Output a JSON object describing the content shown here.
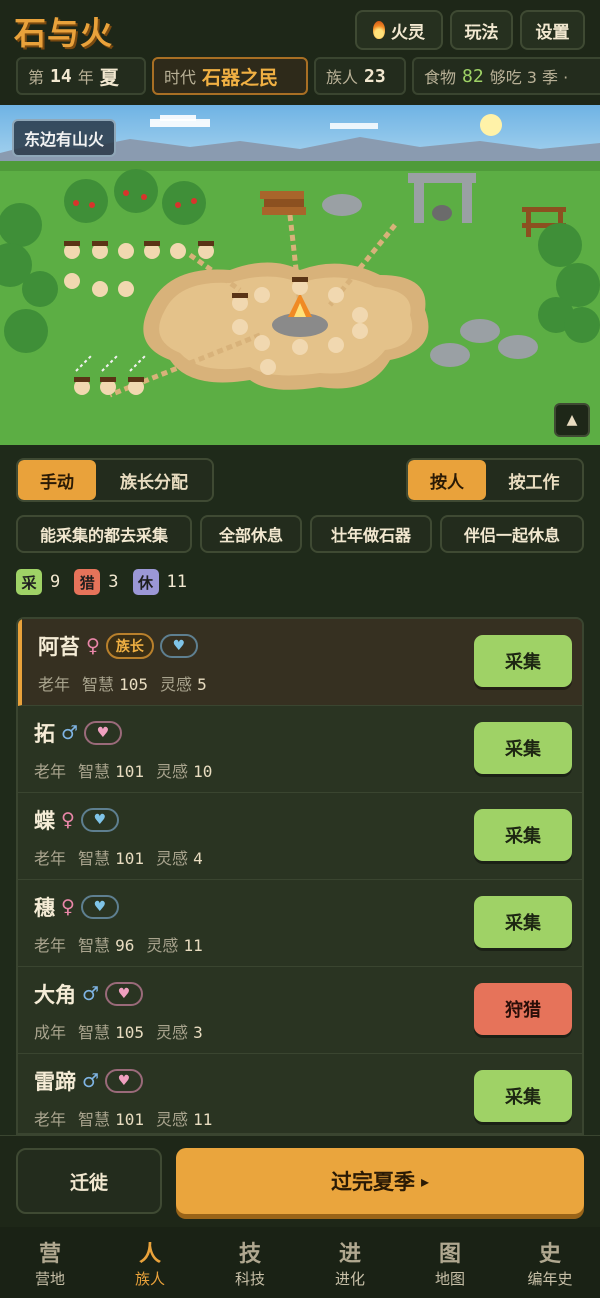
{
  "header": {
    "logo": "石与火",
    "buttons": {
      "fire_spirit": "火灵",
      "how_to_play": "玩法",
      "settings": "设置"
    }
  },
  "status": {
    "year_prefix": "第",
    "year": "14",
    "year_suffix": "年",
    "season": "夏",
    "era_label": "时代",
    "era_value": "石器之民",
    "population_label": "族人",
    "population": "23",
    "food_label": "食物",
    "food": "82",
    "food_note": "够吃 3 季 ·"
  },
  "scene": {
    "event_tag": "东边有山火",
    "expand_icon": "▲"
  },
  "controls": {
    "mode_tabs": [
      "手动",
      "族长分配"
    ],
    "mode_active": 0,
    "sort_tabs": [
      "按人",
      "按工作"
    ],
    "sort_active": 0,
    "quick_actions": [
      "能采集的都去采集",
      "全部休息",
      "壮年做石器",
      "伴侣一起休息"
    ]
  },
  "job_counts": [
    {
      "label": "采",
      "count": "9",
      "color": "#9fd266"
    },
    {
      "label": "猎",
      "count": "3",
      "color": "#e6735a"
    },
    {
      "label": "休",
      "count": "11",
      "color": "#9b97d6"
    }
  ],
  "people": [
    {
      "name": "阿苔",
      "gender": "♀",
      "chief": "族长",
      "heart": "♥",
      "age": "老年",
      "wisdom_label": "智慧",
      "wisdom": "105",
      "insight_label": "灵感",
      "insight": "5",
      "job": "采集"
    },
    {
      "name": "拓",
      "gender": "♂",
      "heart": "♥",
      "age": "老年",
      "wisdom_label": "智慧",
      "wisdom": "101",
      "insight_label": "灵感",
      "insight": "10",
      "job": "采集"
    },
    {
      "name": "蝶",
      "gender": "♀",
      "heart": "♥",
      "age": "老年",
      "wisdom_label": "智慧",
      "wisdom": "101",
      "insight_label": "灵感",
      "insight": "4",
      "job": "采集"
    },
    {
      "name": "穗",
      "gender": "♀",
      "heart": "♥",
      "age": "老年",
      "wisdom_label": "智慧",
      "wisdom": "96",
      "insight_label": "灵感",
      "insight": "11",
      "job": "采集"
    },
    {
      "name": "大角",
      "gender": "♂",
      "heart": "♥",
      "age": "成年",
      "wisdom_label": "智慧",
      "wisdom": "105",
      "insight_label": "灵感",
      "insight": "3",
      "job": "狩猎"
    },
    {
      "name": "雷蹄",
      "gender": "♂",
      "heart": "♥",
      "age": "老年",
      "wisdom_label": "智慧",
      "wisdom": "101",
      "insight_label": "灵感",
      "insight": "11",
      "job": "采集"
    }
  ],
  "actions": {
    "migrate": "迁徙",
    "end_season": "过完夏季",
    "end_arrow": "▸"
  },
  "nav": [
    {
      "icon": "营",
      "label": "营地"
    },
    {
      "icon": "人",
      "label": "族人"
    },
    {
      "icon": "技",
      "label": "科技"
    },
    {
      "icon": "进",
      "label": "进化"
    },
    {
      "icon": "图",
      "label": "地图"
    },
    {
      "icon": "史",
      "label": "编年史"
    }
  ],
  "nav_active": 1
}
